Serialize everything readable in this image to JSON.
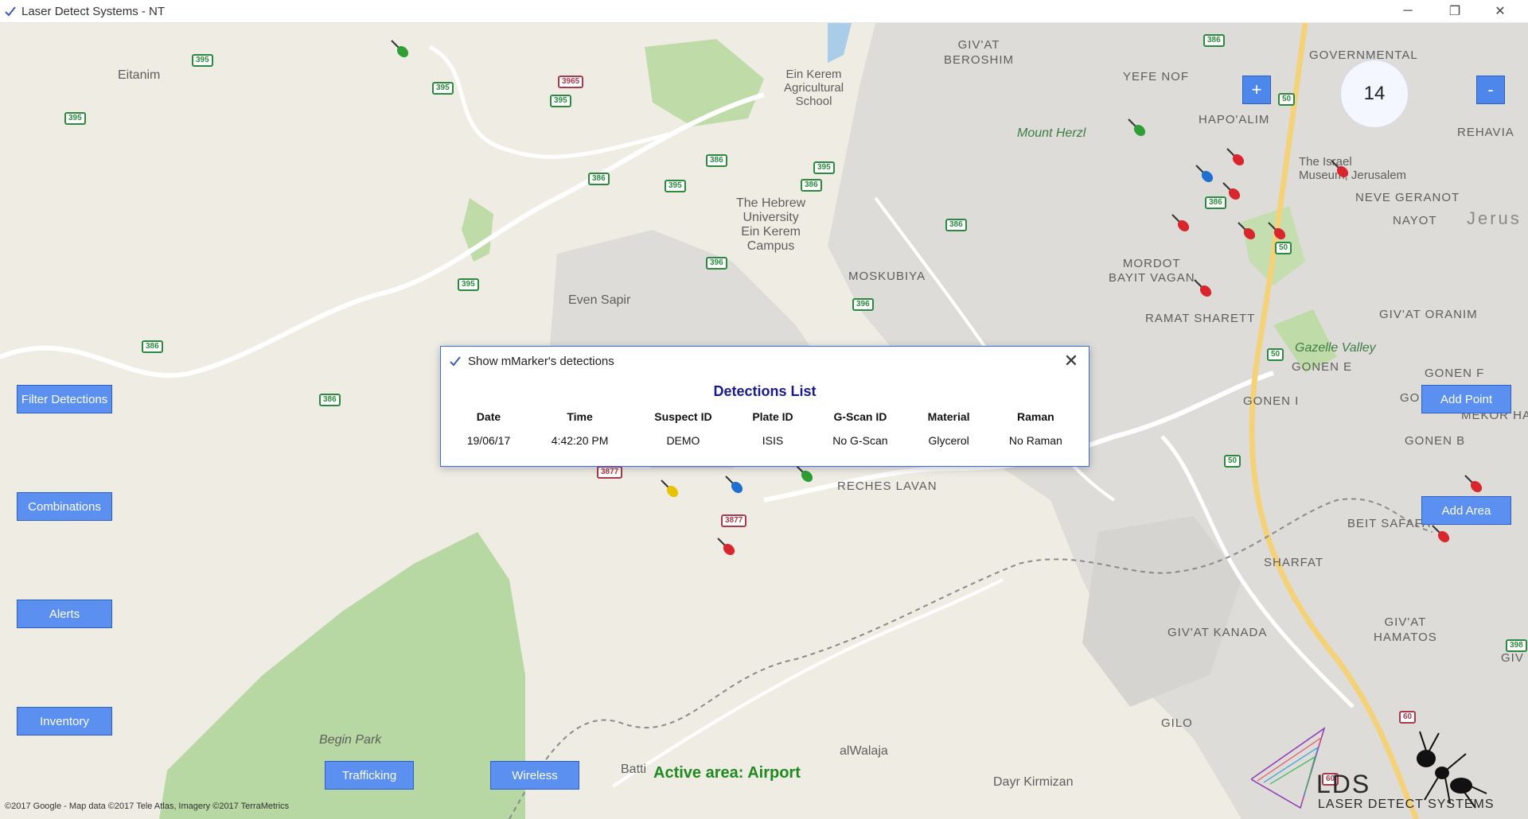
{
  "window": {
    "title": "Laser Detect Systems - NT",
    "minimize_label": "─",
    "maximize_label": "❐",
    "close_label": "✕"
  },
  "map": {
    "zoom_level": "14",
    "zoom_in_label": "+",
    "zoom_out_label": "-",
    "active_area": "Active area: Airport",
    "copyright": "©2017 Google - Map data ©2017 Tele Atlas, Imagery ©2017 TerraMetrics",
    "labels": {
      "eitanim": "Eitanim",
      "givat_beroshim": "GIV'AT\nBEROSHIM",
      "ein_kerem_school": "Ein Kerem\nAgricultural\nSchool",
      "yefe_nof": "YEFE NOF",
      "governmental": "GOVERNMENTAL",
      "hapoalim": "HAPO'ALIM",
      "rehavia": "REHAVIA",
      "mount_herzl": "Mount Herzl",
      "israel_museum": "The Israel\nMuseum, Jerusalem",
      "neve_geranot": "NEVE GERANOT",
      "nayot": "NAYOT",
      "jerus": "Jerus",
      "hebrew_univ": "The Hebrew\nUniversity\nEin Kerem\nCampus",
      "mordot": "MORDOT\nBAYIT VAGAN",
      "moskubiya": "MOSKUBIYA",
      "even_sapir": "Even Sapir",
      "ramat_sharett": "RAMAT SHARETT",
      "givat_oranim": "GIV'AT ORANIM",
      "gazelle_valley": "Gazelle Valley",
      "gonen_e": "GONEN E",
      "gonen_f": "GONEN F",
      "gonen_i": "GONEN I",
      "go": "GO",
      "mekor_ha": "MEKOR HA",
      "gonen_b": "GONEN B",
      "reches_lavan": "RECHES LAVAN",
      "beit_safafa": "BEIT SAFAFA",
      "sharfat": "SHARFAT",
      "givat_kanada": "GIV'AT KANADA",
      "givat_hamatos": "GIV'AT\nHAMATOS",
      "giv": "GIV",
      "gilo": "GILO",
      "begin_park": "Begin Park",
      "alwalaja": "alWalaja",
      "dayr_kirmizan": "Dayr Kirmizan",
      "batti": "Batti"
    },
    "road_shields": [
      "395",
      "395",
      "395",
      "395",
      "3965",
      "395",
      "386",
      "395",
      "386",
      "395",
      "386",
      "386",
      "386",
      "396",
      "396",
      "386",
      "386",
      "386",
      "50",
      "50",
      "50",
      "50",
      "3877",
      "3877",
      "60",
      "60",
      "398"
    ]
  },
  "sidebar": {
    "filter_detections": "Filter Detections",
    "combinations": "Combinations",
    "alerts": "Alerts",
    "inventory": "Inventory"
  },
  "bottom": {
    "trafficking": "Trafficking",
    "wireless": "Wireless"
  },
  "right": {
    "add_point": "Add Point",
    "add_area": "Add Area"
  },
  "dialog": {
    "title": "Show mMarker's detections",
    "heading": "Detections List",
    "columns": [
      "Date",
      "Time",
      "Suspect ID",
      "Plate ID",
      "G-Scan ID",
      "Material",
      "Raman"
    ],
    "rows": [
      [
        "19/06/17",
        "4:42:20 PM",
        "DEMO",
        "ISIS",
        "No G-Scan",
        "Glycerol",
        "No Raman"
      ]
    ],
    "close_label": "✕"
  },
  "logo": {
    "lds": "LDS",
    "subtitle": "LASER DETECT SYSTEMS"
  },
  "colors": {
    "button_blue": "#5b8ff0",
    "active_green": "#1f8a1f",
    "dialog_heading": "#1a1a8c",
    "pin_red": "#d9262c",
    "pin_blue": "#1e6fd0",
    "pin_green": "#2f9e34",
    "pin_yellow": "#e8c400"
  }
}
